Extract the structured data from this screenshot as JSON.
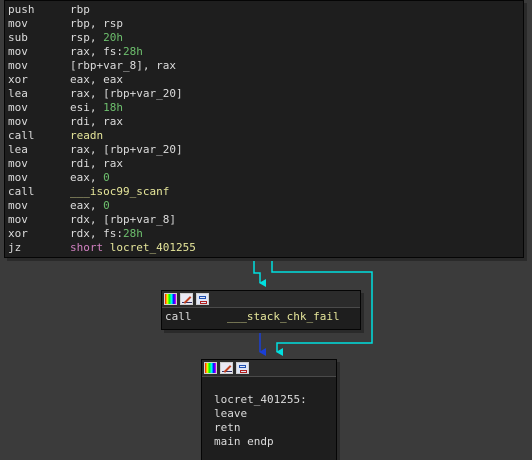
{
  "main_block": {
    "lines": [
      {
        "mnemonic": "push",
        "operands": [
          {
            "t": "rbp",
            "c": "ops"
          }
        ]
      },
      {
        "mnemonic": "mov",
        "operands": [
          {
            "t": "rbp, rsp",
            "c": "ops"
          }
        ]
      },
      {
        "mnemonic": "sub",
        "operands": [
          {
            "t": "rsp, ",
            "c": "ops"
          },
          {
            "t": "20h",
            "c": "num"
          }
        ]
      },
      {
        "mnemonic": "mov",
        "operands": [
          {
            "t": "rax, fs:",
            "c": "ops"
          },
          {
            "t": "28h",
            "c": "num"
          }
        ]
      },
      {
        "mnemonic": "mov",
        "operands": [
          {
            "t": "[rbp+var_8], rax",
            "c": "ops"
          }
        ]
      },
      {
        "mnemonic": "xor",
        "operands": [
          {
            "t": "eax, eax",
            "c": "ops"
          }
        ]
      },
      {
        "mnemonic": "lea",
        "operands": [
          {
            "t": "rax, [rbp+var_20]",
            "c": "ops"
          }
        ]
      },
      {
        "mnemonic": "mov",
        "operands": [
          {
            "t": "esi, ",
            "c": "ops"
          },
          {
            "t": "18h",
            "c": "num"
          }
        ]
      },
      {
        "mnemonic": "mov",
        "operands": [
          {
            "t": "rdi, rax",
            "c": "ops"
          }
        ]
      },
      {
        "mnemonic": "call",
        "operands": [
          {
            "t": "readn",
            "c": "fn"
          }
        ]
      },
      {
        "mnemonic": "lea",
        "operands": [
          {
            "t": "rax, [rbp+var_20]",
            "c": "ops"
          }
        ]
      },
      {
        "mnemonic": "mov",
        "operands": [
          {
            "t": "rdi, rax",
            "c": "ops"
          }
        ]
      },
      {
        "mnemonic": "mov",
        "operands": [
          {
            "t": "eax, ",
            "c": "ops"
          },
          {
            "t": "0",
            "c": "num"
          }
        ]
      },
      {
        "mnemonic": "call",
        "operands": [
          {
            "t": "___isoc99_scanf",
            "c": "fn"
          }
        ]
      },
      {
        "mnemonic": "mov",
        "operands": [
          {
            "t": "eax, ",
            "c": "ops"
          },
          {
            "t": "0",
            "c": "num"
          }
        ]
      },
      {
        "mnemonic": "mov",
        "operands": [
          {
            "t": "rdx, [rbp+var_8]",
            "c": "ops"
          }
        ]
      },
      {
        "mnemonic": "xor",
        "operands": [
          {
            "t": "rdx, fs:",
            "c": "ops"
          },
          {
            "t": "28h",
            "c": "num"
          }
        ]
      },
      {
        "mnemonic": "jz",
        "operands": [
          {
            "t": "short ",
            "c": "kw"
          },
          {
            "t": "locret_401255",
            "c": "fn"
          }
        ]
      }
    ]
  },
  "chk_block": {
    "icons": [
      "color-palette-icon",
      "rename-icon",
      "graph-overview-icon"
    ],
    "lines": [
      {
        "mnemonic": "call",
        "operands": [
          {
            "t": "___stack_chk_fail",
            "c": "fn"
          }
        ]
      }
    ]
  },
  "ret_block": {
    "icons": [
      "color-palette-icon",
      "rename-icon",
      "graph-overview-icon"
    ],
    "label": "locret_401255:",
    "lines": [
      {
        "mnemonic": "leave",
        "operands": []
      },
      {
        "mnemonic": "retn",
        "operands": []
      },
      {
        "mnemonic": "main endp",
        "operands": []
      }
    ]
  },
  "colors": {
    "background": "#3b3b3b",
    "node_bg": "#1e1e1e",
    "text": "#dcdcdc",
    "number": "#6dbf6d",
    "function": "#e5e59a",
    "keyword": "#d080c0",
    "edge_true": "#00e0e0",
    "edge_false": "#1a3fd6"
  }
}
